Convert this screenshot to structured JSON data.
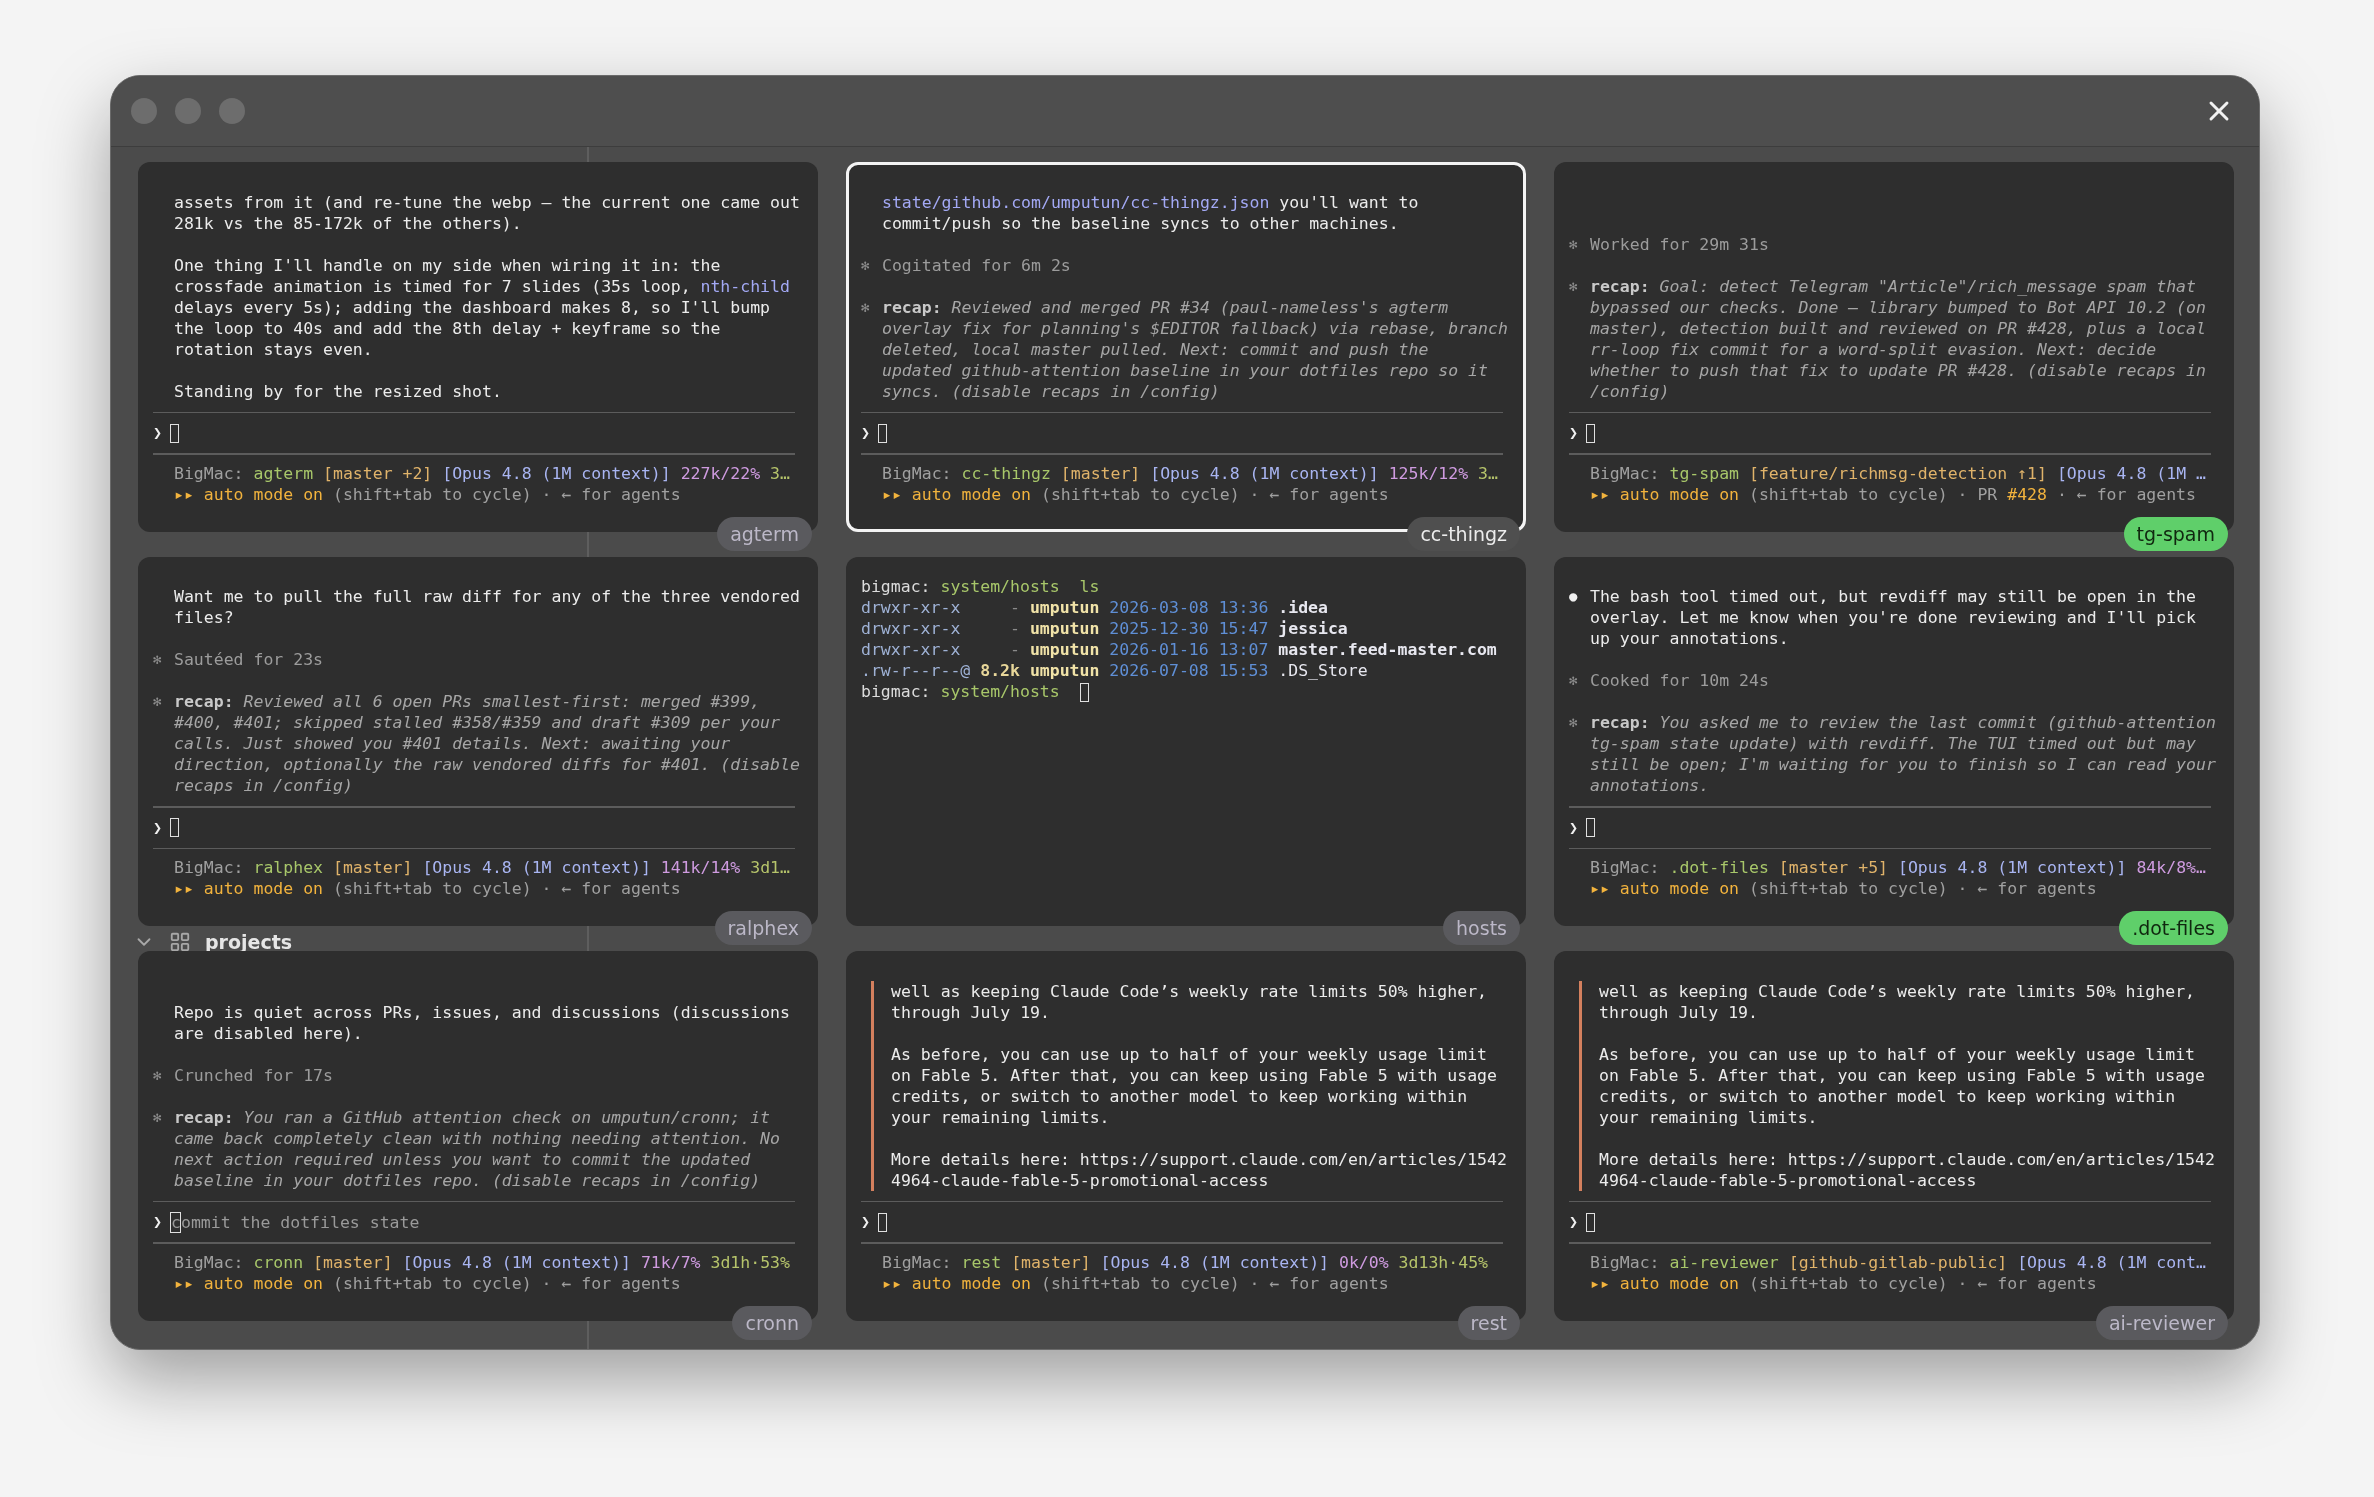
{
  "sidebar": {
    "group": {
      "label": "projects",
      "expanded": true
    }
  },
  "panels": [
    {
      "kind": "agent",
      "label": "agterm",
      "selected": false,
      "attention": false,
      "blocks": [
        {
          "kind": "message",
          "segments": [
            {
              "kind": "plain",
              "text": "assets from it (and re-tune the webp — the current one came out\n281k vs the 85-172k of the others)."
            }
          ]
        },
        {
          "kind": "message",
          "segments": [
            {
              "kind": "plain",
              "text": "One thing I'll handle on my side when wiring it in: the\ncrossfade animation is timed for 7 slides (35s loop, "
            },
            {
              "kind": "code",
              "text": "nth-child"
            },
            {
              "kind": "plain",
              "text": "\ndelays every 5s); adding the dashboard makes 8, so I'll bump\nthe loop to 40s and add the 8th delay + keyframe so the\nrotation stays even."
            }
          ]
        },
        {
          "kind": "message",
          "segments": [
            {
              "kind": "plain",
              "text": "Standing by for the resized shot."
            }
          ]
        }
      ],
      "prompt": {
        "caret": "❯"
      },
      "status": [
        [
          {
            "kind": "host",
            "text": "BigMac: "
          },
          {
            "kind": "repo",
            "text": "agterm "
          },
          {
            "kind": "branch",
            "text": "[master +2] "
          },
          {
            "kind": "model",
            "text": "[Opus 4.8 (1M context)] "
          },
          {
            "kind": "usage",
            "text": "227k/22% "
          },
          {
            "kind": "uptime",
            "text": "3…"
          }
        ],
        [
          {
            "kind": "mode",
            "text": "▸▸ auto mode on"
          },
          {
            "kind": "hint",
            "text": " (shift+tab to cycle) · ← for agents"
          }
        ]
      ]
    },
    {
      "kind": "agent",
      "label": "cc-thingz",
      "selected": true,
      "attention": false,
      "blocks": [
        {
          "kind": "message",
          "segments": [
            {
              "kind": "code",
              "text": "state/github.com/umputun/cc-thingz.json"
            },
            {
              "kind": "plain",
              "text": " you'll want to\ncommit/push so the baseline syncs to other machines."
            }
          ]
        },
        {
          "kind": "status",
          "bullet": "✻",
          "text": "Cogitated for 6m 2s"
        },
        {
          "kind": "recap",
          "bullet": "✻",
          "label": "recap:",
          "text": "Reviewed and merged PR #34 (paul-nameless's agterm\noverlay fix for planning's $EDITOR fallback) via rebase, branch\ndeleted, local master pulled. Next: commit and push the\nupdated github-attention baseline in your dotfiles repo so it\nsyncs. (disable recaps in /config)"
        }
      ],
      "prompt": {
        "caret": "❯"
      },
      "status": [
        [
          {
            "kind": "host",
            "text": "BigMac: "
          },
          {
            "kind": "repo",
            "text": "cc-thingz "
          },
          {
            "kind": "branch",
            "text": "[master] "
          },
          {
            "kind": "model",
            "text": "[Opus 4.8 (1M context)] "
          },
          {
            "kind": "usage",
            "text": "125k/12% "
          },
          {
            "kind": "uptime",
            "text": "3…"
          }
        ],
        [
          {
            "kind": "mode",
            "text": "▸▸ auto mode on"
          },
          {
            "kind": "hint",
            "text": " (shift+tab to cycle) · ← for agents"
          }
        ]
      ]
    },
    {
      "kind": "agent",
      "label": "tg-spam",
      "selected": false,
      "attention": true,
      "blocks": [
        {
          "kind": "status",
          "bullet": "✻",
          "text": "Worked for 29m 31s"
        },
        {
          "kind": "recap",
          "bullet": "✻",
          "label": "recap:",
          "text": "Goal: detect Telegram \"Article\"/rich_message spam that\nbypassed our checks. Done — library bumped to Bot API 10.2 (on\nmaster), detection built and reviewed on PR #428, plus a local\nrr-loop fix commit for a word-split evasion. Next: decide\nwhether to push that fix to update PR #428. (disable recaps in\n/config)"
        }
      ],
      "prompt": {
        "caret": "❯"
      },
      "status": [
        [
          {
            "kind": "host",
            "text": "BigMac: "
          },
          {
            "kind": "repo",
            "text": "tg-spam "
          },
          {
            "kind": "branch",
            "text": "[feature/richmsg-detection ↑1] "
          },
          {
            "kind": "model",
            "text": "[Opus 4.8 (1M …"
          }
        ],
        [
          {
            "kind": "mode",
            "text": "▸▸ auto mode on"
          },
          {
            "kind": "hint",
            "text": " (shift+tab to cycle) · PR "
          },
          {
            "kind": "pr",
            "text": "#428"
          },
          {
            "kind": "hint",
            "text": " · ← for agents"
          }
        ]
      ]
    },
    {
      "kind": "agent",
      "label": "ralphex",
      "selected": false,
      "attention": false,
      "blocks": [
        {
          "kind": "message",
          "segments": [
            {
              "kind": "plain",
              "text": "Want me to pull the full raw diff for any of the three vendored\nfiles?"
            }
          ]
        },
        {
          "kind": "status",
          "bullet": "✻",
          "text": "Sautéed for 23s"
        },
        {
          "kind": "recap",
          "bullet": "✻",
          "label": "recap:",
          "text": "Reviewed all 6 open PRs smallest-first: merged #399,\n#400, #401; skipped stalled #358/#359 and draft #309 per your\ncalls. Just showed you #401 details. Next: awaiting your\ndirection, optionally the raw vendored diffs for #401. (disable\nrecaps in /config)"
        }
      ],
      "prompt": {
        "caret": "❯"
      },
      "status": [
        [
          {
            "kind": "host",
            "text": "BigMac: "
          },
          {
            "kind": "repo",
            "text": "ralphex "
          },
          {
            "kind": "branch",
            "text": "[master] "
          },
          {
            "kind": "model",
            "text": "[Opus 4.8 (1M context)] "
          },
          {
            "kind": "usage",
            "text": "141k/14% "
          },
          {
            "kind": "uptime",
            "text": "3d1…"
          }
        ],
        [
          {
            "kind": "mode",
            "text": "▸▸ auto mode on"
          },
          {
            "kind": "hint",
            "text": " (shift+tab to cycle) · ← for agents"
          }
        ]
      ]
    },
    {
      "kind": "terminal",
      "label": "hosts",
      "selected": false,
      "attention": false,
      "lines": [
        {
          "cursor": false,
          "segments": [
            {
              "kind": "prompt",
              "text": "bigmac: "
            },
            {
              "kind": "path",
              "text": "system/hosts"
            },
            {
              "kind": "cmd",
              "text": "  ls"
            }
          ]
        },
        {
          "cursor": false,
          "segments": [
            {
              "kind": "perm",
              "text": "drwxr-xr-x"
            },
            {
              "kind": "size",
              "text": "     -"
            },
            {
              "kind": "user",
              "text": " umputun"
            },
            {
              "kind": "date",
              "text": " 2026-03-08 13:36"
            },
            {
              "kind": "file",
              "text": " .idea"
            }
          ]
        },
        {
          "cursor": false,
          "segments": [
            {
              "kind": "perm",
              "text": "drwxr-xr-x"
            },
            {
              "kind": "size",
              "text": "     -"
            },
            {
              "kind": "user",
              "text": " umputun"
            },
            {
              "kind": "date",
              "text": " 2025-12-30 15:47"
            },
            {
              "kind": "file",
              "text": " jessica"
            }
          ]
        },
        {
          "cursor": false,
          "segments": [
            {
              "kind": "perm",
              "text": "drwxr-xr-x"
            },
            {
              "kind": "size",
              "text": "     -"
            },
            {
              "kind": "user",
              "text": " umputun"
            },
            {
              "kind": "date",
              "text": " 2026-01-16 13:07"
            },
            {
              "kind": "file",
              "text": " master.feed-master.com"
            }
          ]
        },
        {
          "cursor": false,
          "segments": [
            {
              "kind": "perm",
              "text": ".rw-r--r--@"
            },
            {
              "kind": "sizeval",
              "text": " 8.2k"
            },
            {
              "kind": "user",
              "text": " umputun"
            },
            {
              "kind": "date",
              "text": " 2026-07-08 15:53"
            },
            {
              "kind": "plainfile",
              "text": " .DS_Store"
            }
          ]
        },
        {
          "cursor": true,
          "segments": [
            {
              "kind": "prompt",
              "text": "bigmac: "
            },
            {
              "kind": "path",
              "text": "system/hosts"
            }
          ]
        }
      ]
    },
    {
      "kind": "agent",
      "label": ".dot-files",
      "selected": false,
      "attention": true,
      "blocks": [
        {
          "kind": "message",
          "bullet": "●",
          "segments": [
            {
              "kind": "plain",
              "text": "The bash tool timed out, but revdiff may still be open in the\noverlay. Let me know when you're done reviewing and I'll pick\nup your annotations."
            }
          ]
        },
        {
          "kind": "status",
          "bullet": "✻",
          "text": "Cooked for 10m 24s"
        },
        {
          "kind": "recap",
          "bullet": "✻",
          "label": "recap:",
          "text": "You asked me to review the last commit (github-attention\ntg-spam state update) with revdiff. The TUI timed out but may\nstill be open; I'm waiting for you to finish so I can read your\nannotations."
        }
      ],
      "prompt": {
        "caret": "❯"
      },
      "status": [
        [
          {
            "kind": "host",
            "text": "BigMac: "
          },
          {
            "kind": "repo",
            "text": ".dot-files "
          },
          {
            "kind": "branch",
            "text": "[master +5] "
          },
          {
            "kind": "model",
            "text": "[Opus 4.8 (1M context)] "
          },
          {
            "kind": "usage",
            "text": "84k/8%…"
          }
        ],
        [
          {
            "kind": "mode",
            "text": "▸▸ auto mode on"
          },
          {
            "kind": "hint",
            "text": " (shift+tab to cycle) · ← for agents"
          }
        ]
      ]
    },
    {
      "kind": "agent",
      "label": "cronn",
      "selected": false,
      "attention": false,
      "blocks": [
        {
          "kind": "message",
          "segments": [
            {
              "kind": "plain",
              "text": "Repo is quiet across PRs, issues, and discussions (discussions\nare disabled here)."
            }
          ]
        },
        {
          "kind": "status",
          "bullet": "✻",
          "text": "Crunched for 17s"
        },
        {
          "kind": "recap",
          "bullet": "✻",
          "label": "recap:",
          "text": "You ran a GitHub attention check on umputun/cronn; it\ncame back completely clean with nothing needing attention. No\nnext action required unless you want to commit the updated\nbaseline in your dotfiles repo. (disable recaps in /config)"
        }
      ],
      "prompt": {
        "caret": "❯",
        "value": "commit the dotfiles state"
      },
      "status": [
        [
          {
            "kind": "host",
            "text": "BigMac: "
          },
          {
            "kind": "repo",
            "text": "cronn "
          },
          {
            "kind": "branch",
            "text": "[master] "
          },
          {
            "kind": "model",
            "text": "[Opus 4.8 (1M context)] "
          },
          {
            "kind": "usage",
            "text": "71k/7% "
          },
          {
            "kind": "uptime",
            "text": "3d1h·53%"
          }
        ],
        [
          {
            "kind": "mode",
            "text": "▸▸ auto mode on"
          },
          {
            "kind": "hint",
            "text": " (shift+tab to cycle) · ← for agents"
          }
        ]
      ]
    },
    {
      "kind": "agent",
      "label": "rest",
      "selected": false,
      "attention": false,
      "blocks": [
        {
          "kind": "quote",
          "paragraphs": [
            "well as keeping Claude Code’s weekly rate limits 50% higher,\nthrough July 19.",
            "As before, you can use up to half of your weekly usage limit\non Fable 5. After that, you can keep using Fable 5 with usage\ncredits, or switch to another model to keep working within\nyour remaining limits.",
            "More details here: https://support.claude.com/en/articles/1542\n4964-claude-fable-5-promotional-access"
          ]
        }
      ],
      "prompt": {
        "caret": "❯"
      },
      "status": [
        [
          {
            "kind": "host",
            "text": "BigMac: "
          },
          {
            "kind": "repo",
            "text": "rest "
          },
          {
            "kind": "branch",
            "text": "[master] "
          },
          {
            "kind": "model",
            "text": "[Opus 4.8 (1M context)] "
          },
          {
            "kind": "usage",
            "text": "0k/0% "
          },
          {
            "kind": "uptime",
            "text": "3d13h·45%"
          }
        ],
        [
          {
            "kind": "mode",
            "text": "▸▸ auto mode on"
          },
          {
            "kind": "hint",
            "text": " (shift+tab to cycle) · ← for agents"
          }
        ]
      ]
    },
    {
      "kind": "agent",
      "label": "ai-reviewer",
      "selected": false,
      "attention": false,
      "blocks": [
        {
          "kind": "quote",
          "paragraphs": [
            "well as keeping Claude Code’s weekly rate limits 50% higher,\nthrough July 19.",
            "As before, you can use up to half of your weekly usage limit\non Fable 5. After that, you can keep using Fable 5 with usage\ncredits, or switch to another model to keep working within\nyour remaining limits.",
            "More details here: https://support.claude.com/en/articles/1542\n4964-claude-fable-5-promotional-access"
          ]
        }
      ],
      "prompt": {
        "caret": "❯"
      },
      "status": [
        [
          {
            "kind": "host",
            "text": "BigMac: "
          },
          {
            "kind": "repo",
            "text": "ai-reviewer "
          },
          {
            "kind": "branch",
            "text": "[github-gitlab-public] "
          },
          {
            "kind": "model",
            "text": "[Opus 4.8 (1M cont…"
          }
        ],
        [
          {
            "kind": "mode",
            "text": "▸▸ auto mode on"
          },
          {
            "kind": "hint",
            "text": " (shift+tab to cycle) · ← for agents"
          }
        ]
      ]
    }
  ]
}
